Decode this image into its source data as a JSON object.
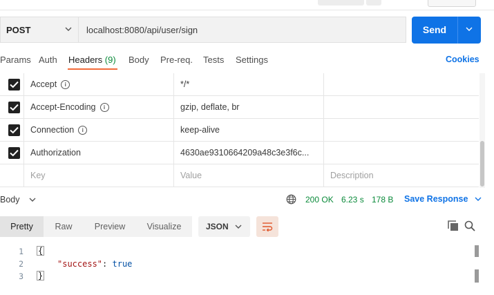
{
  "request": {
    "method": "POST",
    "url": "localhost:8080/api/user/sign",
    "send_label": "Send"
  },
  "tabs": {
    "params": "Params",
    "auth": "Auth",
    "headers": "Headers",
    "headers_count": "(9)",
    "body": "Body",
    "prereq": "Pre-req.",
    "tests": "Tests",
    "settings": "Settings",
    "cookies": "Cookies"
  },
  "headers_table": {
    "rows": [
      {
        "key": "Accept",
        "value": "*/*",
        "checked": true,
        "info": true
      },
      {
        "key": "Accept-Encoding",
        "value": "gzip, deflate, br",
        "checked": true,
        "info": true
      },
      {
        "key": "Connection",
        "value": "keep-alive",
        "checked": true,
        "info": true
      },
      {
        "key": "Authorization",
        "value": "4630ae9310664209a48c3e3f6c...",
        "checked": true,
        "info": false
      }
    ],
    "placeholders": {
      "key": "Key",
      "value": "Value",
      "description": "Description"
    }
  },
  "response": {
    "body_label": "Body",
    "status": "200 OK",
    "time": "6.23 s",
    "size": "178 B",
    "save_label": "Save Response",
    "view_tabs": [
      "Pretty",
      "Raw",
      "Preview",
      "Visualize"
    ],
    "format": "JSON",
    "line_numbers": [
      "1",
      "2",
      "3"
    ],
    "open_brace": "{",
    "close_brace": "}",
    "json_key": "\"success\"",
    "json_colon": ":",
    "json_value": "true"
  },
  "colors": {
    "accent": "#0f73e6",
    "active_tab_underline": "#f26b3a",
    "status_ok": "#0a8a3a"
  }
}
